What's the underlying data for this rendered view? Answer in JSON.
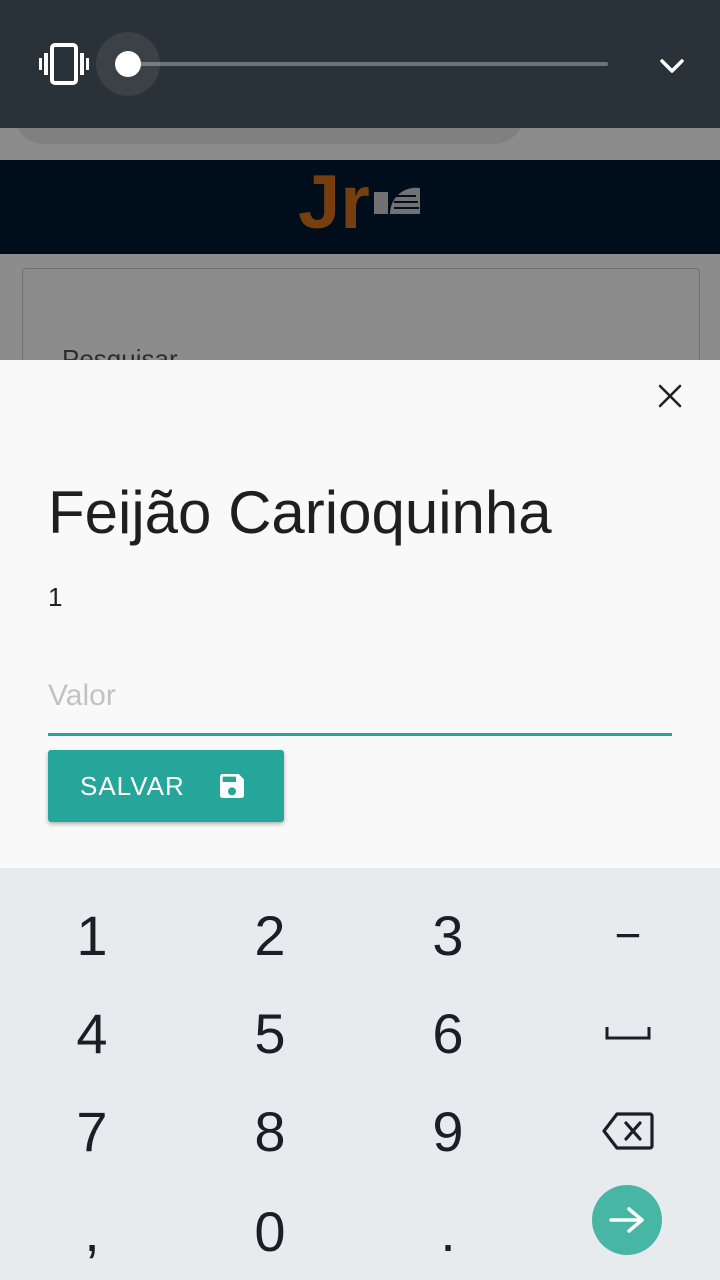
{
  "volume_panel": {
    "mode_icon": "vibrate-icon",
    "level_percent": 0,
    "collapse_icon": "chevron-down-icon"
  },
  "background_app": {
    "logo_text": "Jr",
    "search_label": "Pesquisar"
  },
  "dialog": {
    "title": "Feijão Carioquinha",
    "quantity": "1",
    "valor_placeholder": "Valor",
    "valor_value": "",
    "save_label": "SALVAR",
    "close_icon": "close-icon",
    "save_icon": "save-icon"
  },
  "keyboard": {
    "row1": [
      "1",
      "2",
      "3",
      "−"
    ],
    "row2": [
      "4",
      "5",
      "6"
    ],
    "row3": [
      "7",
      "8",
      "9"
    ],
    "row4": [
      ",",
      "0",
      "."
    ],
    "space_icon": "space-icon",
    "backspace_icon": "backspace-icon",
    "enter_icon": "arrow-right-icon"
  },
  "colors": {
    "accent": "#26a69a",
    "volume_bg": "#2a3239",
    "header_bg": "#001b33",
    "keyboard_bg": "#e8ebee",
    "logo_orange": "#d9731c"
  }
}
